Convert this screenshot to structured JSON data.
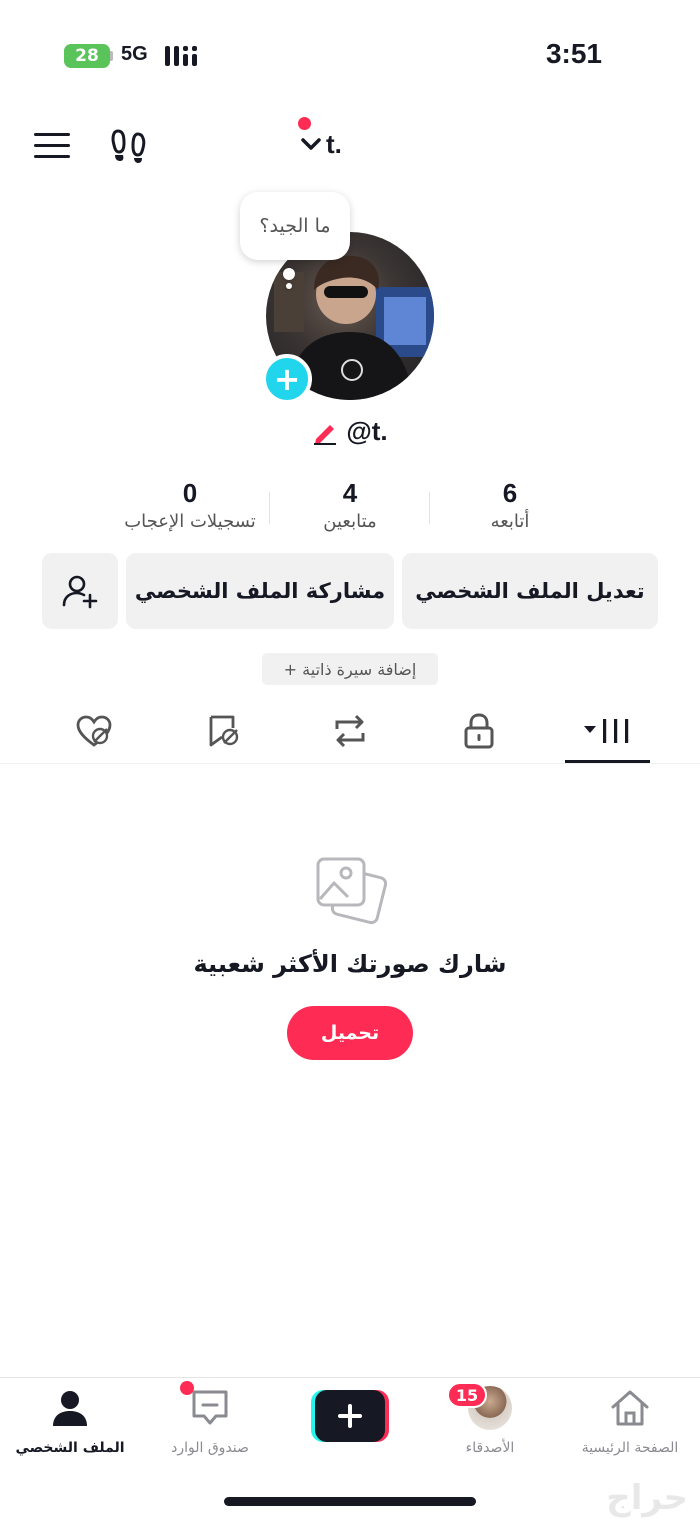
{
  "status_bar": {
    "battery": "28",
    "network": "5G",
    "time": "3:51"
  },
  "header": {
    "account_name": "t.",
    "menu_icon": "hamburger-icon",
    "footprint_icon": "footprint-icon"
  },
  "profile": {
    "thought_bubble": "ما الجيد؟",
    "username": "@t.",
    "stats": [
      {
        "value": "0",
        "label": "تسجيلات الإعجاب"
      },
      {
        "value": "4",
        "label": "متابعين"
      },
      {
        "value": "6",
        "label": "أتابعه"
      }
    ],
    "edit_profile": "تعديل الملف الشخصي",
    "share_profile": "مشاركة الملف الشخصي",
    "add_bio": "+ إضافة سيرة ذاتية"
  },
  "tabs": [
    "liked-hidden-icon",
    "favorites-icon",
    "repost-icon",
    "lock-icon",
    "grid-icon"
  ],
  "empty_state": {
    "title": "شارك صورتك الأكثر شعبية",
    "upload": "تحميل"
  },
  "bottom_nav": {
    "profile": "الملف الشخصي",
    "inbox": "صندوق الوارد",
    "friends": "الأصدقاء",
    "friends_badge": "15",
    "home": "الصفحة الرئيسية"
  },
  "watermark": "حراج",
  "colors": {
    "accent": "#fe2c55",
    "cyan": "#20d5ec",
    "button_bg": "#f1f1f2"
  }
}
